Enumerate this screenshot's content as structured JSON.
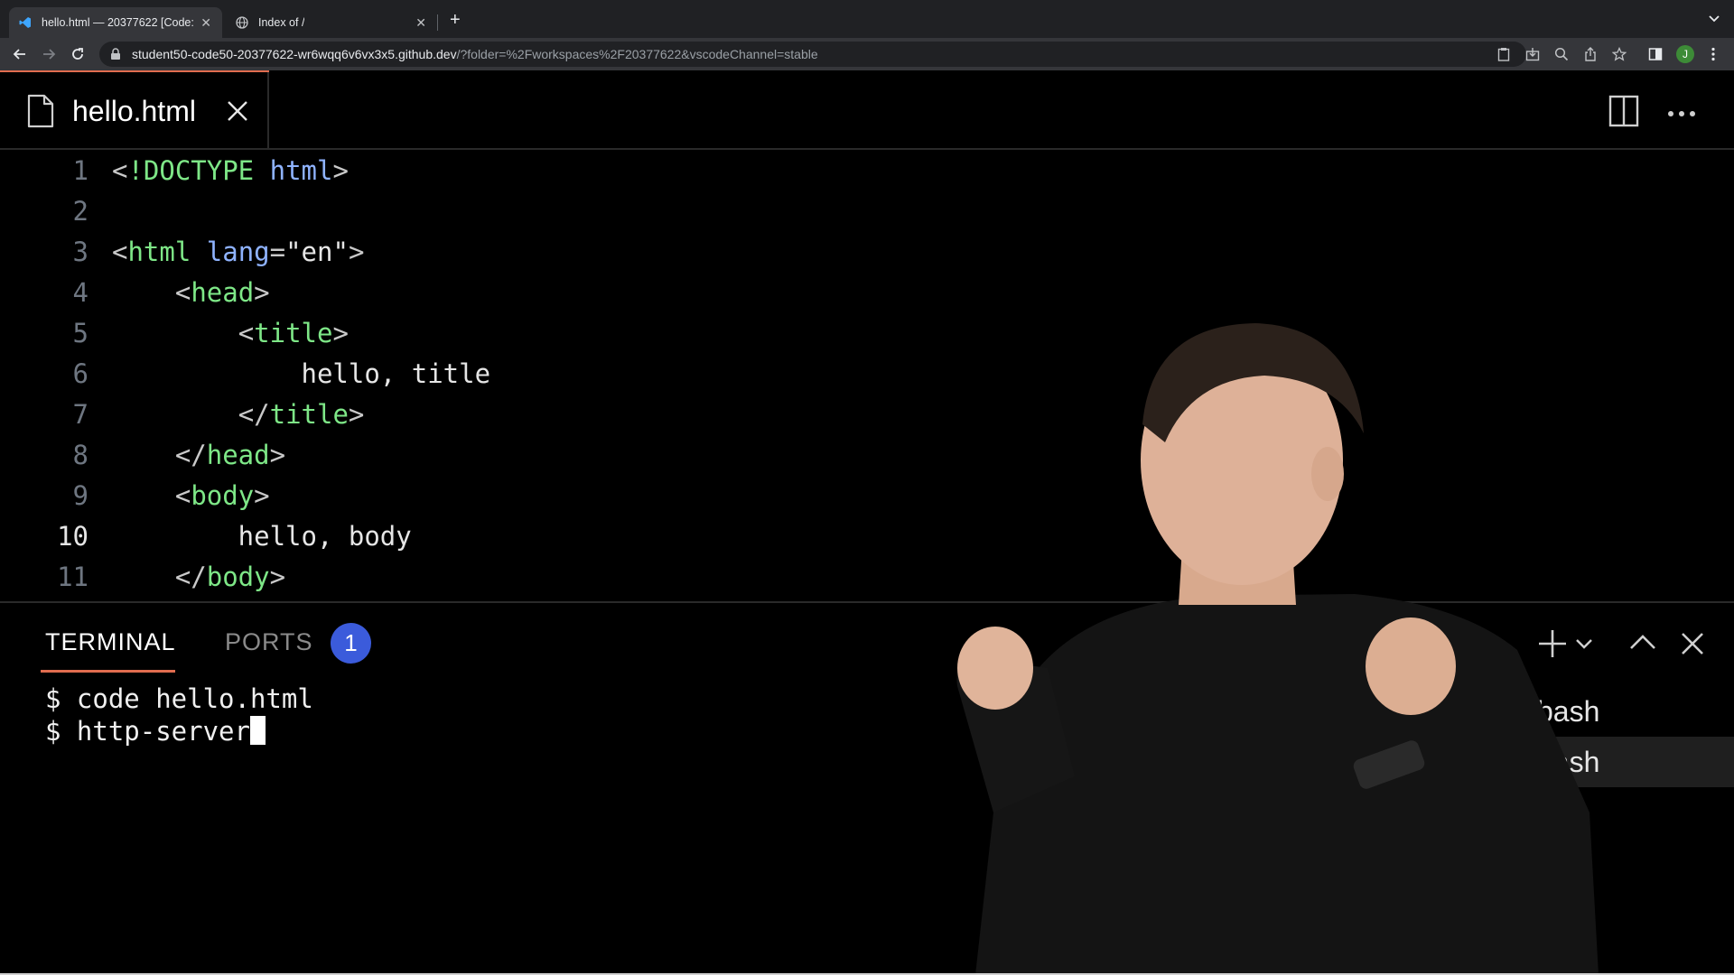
{
  "browser": {
    "tabs": [
      {
        "title": "hello.html — 20377622 [Code:",
        "active": true
      },
      {
        "title": "Index of /",
        "active": false
      }
    ],
    "url_host": "student50-code50-20377622-wr6wqq6v6vx3x5.github.dev",
    "url_rest": "/?folder=%2Fworkspaces%2F20377622&vscodeChannel=stable",
    "profile_initial": "J",
    "colors": {
      "tabbar": "#202124",
      "toolbar": "#35363a",
      "profile": "#3d8b37"
    }
  },
  "editor": {
    "tab_filename": "hello.html",
    "current_line": 10,
    "lines": [
      {
        "n": "1",
        "tokens": [
          {
            "t": "<",
            "c": "br"
          },
          {
            "t": "!DOCTYPE",
            "c": "tag"
          },
          {
            "t": " ",
            "c": "txt"
          },
          {
            "t": "html",
            "c": "attr"
          },
          {
            "t": ">",
            "c": "br"
          }
        ]
      },
      {
        "n": "2",
        "tokens": []
      },
      {
        "n": "3",
        "tokens": [
          {
            "t": "<",
            "c": "br"
          },
          {
            "t": "html",
            "c": "tag"
          },
          {
            "t": " ",
            "c": "txt"
          },
          {
            "t": "lang",
            "c": "attr"
          },
          {
            "t": "=",
            "c": "br"
          },
          {
            "t": "\"en\"",
            "c": "str"
          },
          {
            "t": ">",
            "c": "br"
          }
        ]
      },
      {
        "n": "4",
        "tokens": [
          {
            "t": "    ",
            "c": "txt"
          },
          {
            "t": "<",
            "c": "br"
          },
          {
            "t": "head",
            "c": "tag"
          },
          {
            "t": ">",
            "c": "br"
          }
        ]
      },
      {
        "n": "5",
        "tokens": [
          {
            "t": "        ",
            "c": "txt"
          },
          {
            "t": "<",
            "c": "br"
          },
          {
            "t": "title",
            "c": "tag"
          },
          {
            "t": ">",
            "c": "br"
          }
        ]
      },
      {
        "n": "6",
        "tokens": [
          {
            "t": "            hello, title",
            "c": "txt"
          }
        ]
      },
      {
        "n": "7",
        "tokens": [
          {
            "t": "        ",
            "c": "txt"
          },
          {
            "t": "</",
            "c": "br"
          },
          {
            "t": "title",
            "c": "tag"
          },
          {
            "t": ">",
            "c": "br"
          }
        ]
      },
      {
        "n": "8",
        "tokens": [
          {
            "t": "    ",
            "c": "txt"
          },
          {
            "t": "</",
            "c": "br"
          },
          {
            "t": "head",
            "c": "tag"
          },
          {
            "t": ">",
            "c": "br"
          }
        ]
      },
      {
        "n": "9",
        "tokens": [
          {
            "t": "    ",
            "c": "txt"
          },
          {
            "t": "<",
            "c": "br"
          },
          {
            "t": "body",
            "c": "tag"
          },
          {
            "t": ">",
            "c": "br"
          }
        ]
      },
      {
        "n": "10",
        "tokens": [
          {
            "t": "        hello, body",
            "c": "txt"
          }
        ]
      },
      {
        "n": "11",
        "tokens": [
          {
            "t": "    ",
            "c": "txt"
          },
          {
            "t": "</",
            "c": "br"
          },
          {
            "t": "body",
            "c": "tag"
          },
          {
            "t": ">",
            "c": "br"
          }
        ]
      }
    ],
    "colors": {
      "tag": "#7ee787",
      "attr": "#8fb3ff",
      "accent": "#e06c4f"
    }
  },
  "panel": {
    "tabs": {
      "terminal": "TERMINAL",
      "ports": "PORTS"
    },
    "ports_count": "1",
    "terminal_lines": [
      "$ code hello.html",
      "$ http-server"
    ],
    "shells": [
      "bash",
      "bash"
    ],
    "colors": {
      "badge": "#3b5bdb"
    }
  }
}
